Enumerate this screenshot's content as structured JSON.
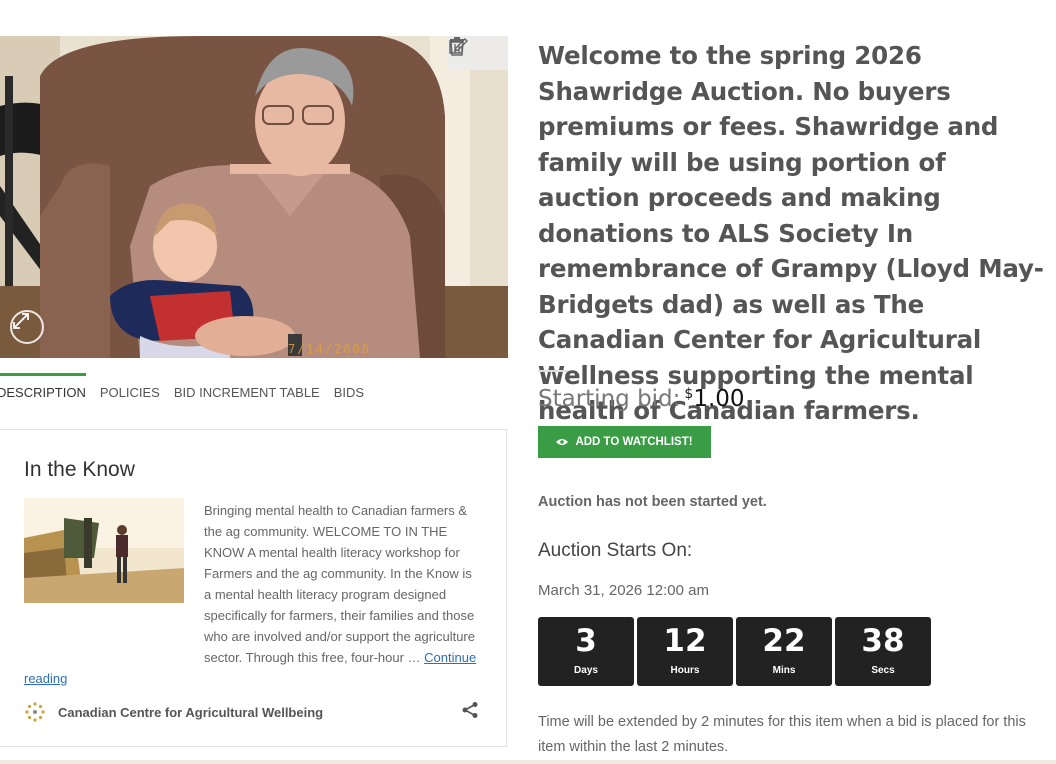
{
  "photo": {
    "date_stamp": "7/14/2008",
    "toolbar_icons": [
      "edit-icon",
      "trash-icon"
    ],
    "zoom_icon": "expand-icon"
  },
  "tabs": [
    {
      "label": "DESCRIPTION",
      "active": true
    },
    {
      "label": "POLICIES",
      "active": false
    },
    {
      "label": "BID INCREMENT TABLE",
      "active": false
    },
    {
      "label": "BIDS",
      "active": false
    }
  ],
  "card": {
    "title": "In the Know",
    "excerpt": "Bringing mental health to Canadian farmers & the ag community. WELCOME TO IN THE KNOW A mental health literacy workshop for Farmers and the ag community. In the Know is a mental health literacy program designed specifically for farmers, their families and those who are involved and/or support the agriculture sector.  Through this free, four-hour …",
    "read_more": "Continue reading",
    "source": "Canadian Centre for Agricultural Wellbeing",
    "share_icon": "share-icon"
  },
  "auction": {
    "headline": "Welcome to the spring 2026 Shawridge Auction. No buyers premiums or fees. Shawridge and family will be using portion of auction proceeds and making donations to ALS Society In remembrance of Grampy (Lloyd May-Bridgets dad) as well as The Canadian Center for Agricultural Wellness supporting the mental health of Canadian farmers.",
    "starting_bid_label": "Starting bid:",
    "currency": "$",
    "starting_bid_amount": "1.00",
    "watchlist_button": "ADD TO WATCHLIST!",
    "status": "Auction has not been started yet.",
    "starts_on_heading": "Auction Starts On:",
    "starts_on_date": "March 31, 2026 12:00 am",
    "countdown": [
      {
        "value": "3",
        "label": "Days"
      },
      {
        "value": "12",
        "label": "Hours"
      },
      {
        "value": "22",
        "label": "Mins"
      },
      {
        "value": "38",
        "label": "Secs"
      }
    ],
    "extension_note": "Time will be extended by 2 minutes for this item when a bid is placed for this item within the last 2 minutes."
  },
  "colors": {
    "accent_green": "#3a9c45",
    "countdown_bg": "#222222",
    "link_blue": "#2b6fb6"
  }
}
